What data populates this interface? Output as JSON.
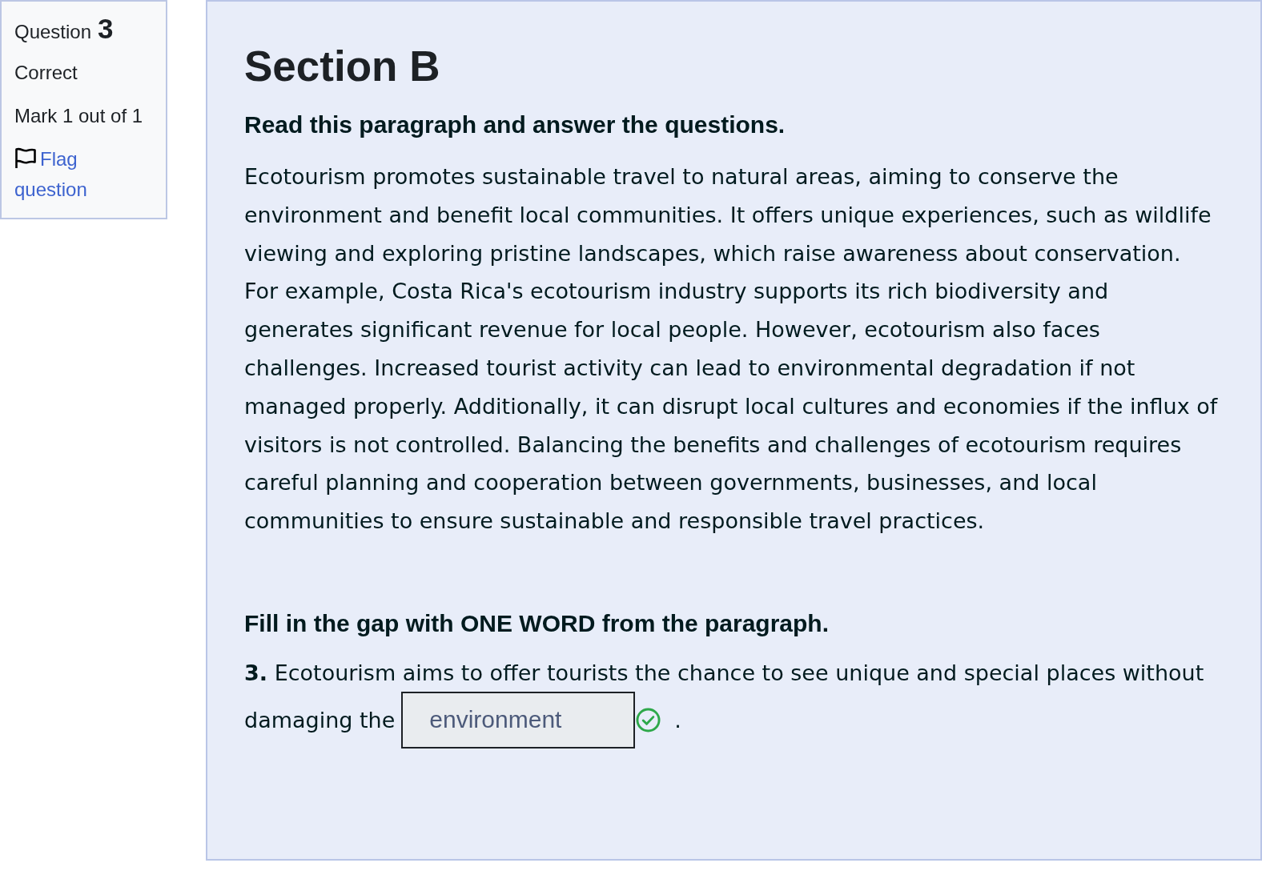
{
  "sidebar": {
    "question_label": "Question",
    "question_number": "3",
    "status": "Correct",
    "mark": "Mark 1 out of 1",
    "flag_link": "Flag question"
  },
  "content": {
    "heading": "Section B",
    "instruction": "Read this paragraph and answer the questions.",
    "paragraph": "Ecotourism promotes sustainable travel to natural areas, aiming to conserve the environment and benefit local communities. It offers unique experiences, such as wildlife viewing and exploring pristine landscapes, which raise awareness about conservation. For example, Costa Rica's ecotourism industry supports its rich biodiversity and generates significant revenue for local people. However, ecotourism also faces challenges. Increased tourist activity can lead to environmental degradation if not managed properly. Additionally, it can disrupt local cultures and economies if the influx of visitors is not controlled. Balancing the benefits and challenges of ecotourism requires careful planning and cooperation between governments, businesses, and local communities to ensure sustainable and responsible travel practices.",
    "task": "Fill in the gap with ONE WORD from the paragraph.",
    "question": {
      "first_line": "**3.** Ecotourism aims to offer tourists the chance to see unique and special places without",
      "text_before": "damaging the",
      "answer": "environment",
      "correct": true,
      "text_after": "."
    }
  }
}
